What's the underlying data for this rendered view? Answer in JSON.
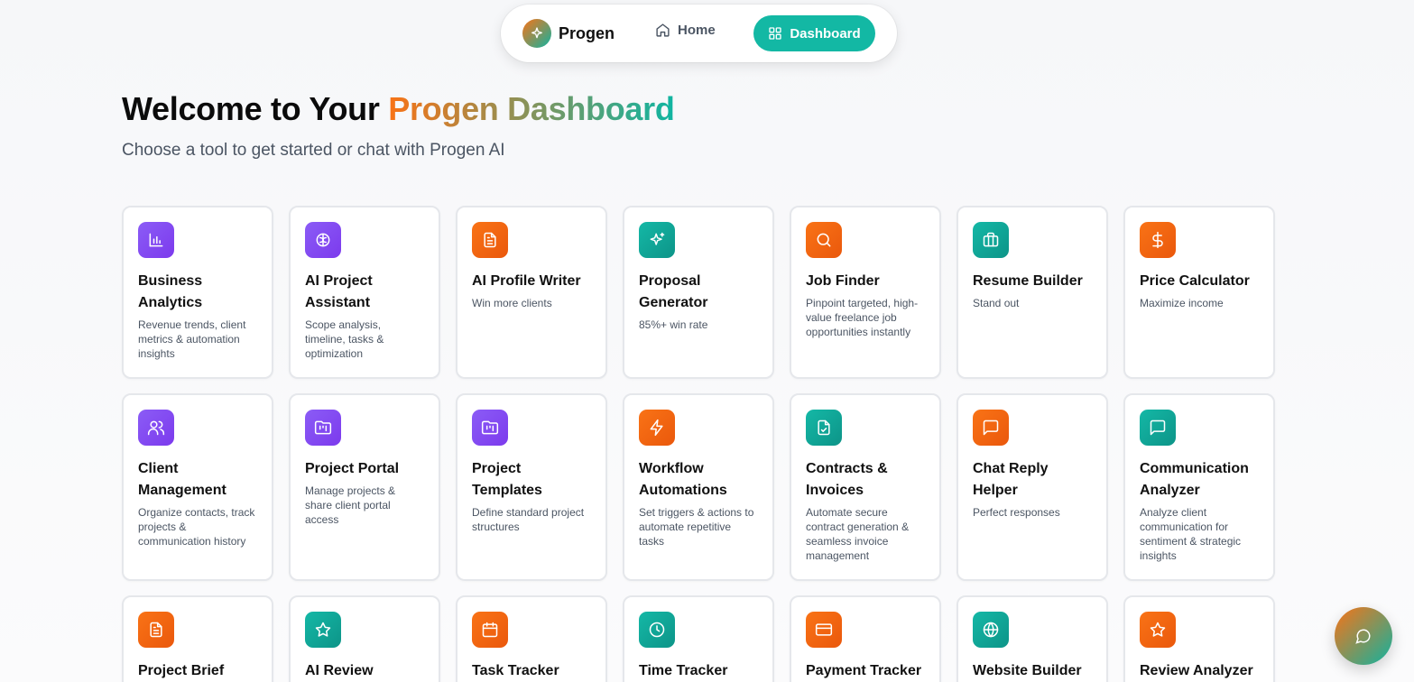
{
  "nav": {
    "brand": "Progen",
    "home_label": "Home",
    "dashboard_label": "Dashboard"
  },
  "header": {
    "title_prefix": "Welcome to Your ",
    "title_highlight": "Progen Dashboard",
    "subtitle": "Choose a tool to get started or chat with Progen AI"
  },
  "tools": [
    {
      "title": "Business Analytics",
      "desc": "Revenue trends, client metrics & automation insights",
      "color": "purple",
      "icon": "bar-chart-icon"
    },
    {
      "title": "AI Project Assistant",
      "desc": "Scope analysis, timeline, tasks & optimization",
      "color": "purple",
      "icon": "brain-icon"
    },
    {
      "title": "AI Profile Writer",
      "desc": "Win more clients",
      "color": "orange",
      "icon": "document-icon"
    },
    {
      "title": "Proposal Generator",
      "desc": "85%+ win rate",
      "color": "teal",
      "icon": "sparkles-icon"
    },
    {
      "title": "Job Finder",
      "desc": "Pinpoint targeted, high-value freelance job opportunities instantly",
      "color": "orange",
      "icon": "search-icon"
    },
    {
      "title": "Resume Builder",
      "desc": "Stand out",
      "color": "teal",
      "icon": "briefcase-icon"
    },
    {
      "title": "Price Calculator",
      "desc": "Maximize income",
      "color": "orange",
      "icon": "dollar-icon"
    },
    {
      "title": "Client Management",
      "desc": "Organize contacts, track projects & communication history",
      "color": "purple",
      "icon": "users-icon"
    },
    {
      "title": "Project Portal",
      "desc": "Manage projects & share client portal access",
      "color": "purple",
      "icon": "folder-kanban-icon"
    },
    {
      "title": "Project Templates",
      "desc": "Define standard project structures",
      "color": "purple",
      "icon": "folder-kanban-icon"
    },
    {
      "title": "Workflow Automations",
      "desc": "Set triggers & actions to automate repetitive tasks",
      "color": "orange",
      "icon": "lightning-icon"
    },
    {
      "title": "Contracts & Invoices",
      "desc": "Automate secure contract generation & seamless invoice management",
      "color": "teal",
      "icon": "file-check-icon"
    },
    {
      "title": "Chat Reply Helper",
      "desc": "Perfect responses",
      "color": "orange",
      "icon": "message-square-icon"
    },
    {
      "title": "Communication Analyzer",
      "desc": "Analyze client communication for sentiment & strategic insights",
      "color": "teal",
      "icon": "message-square-icon"
    },
    {
      "title": "Project Brief",
      "desc": "",
      "color": "orange",
      "icon": "document-icon"
    },
    {
      "title": "AI Review",
      "desc": "",
      "color": "teal",
      "icon": "star-icon"
    },
    {
      "title": "Task Tracker",
      "desc": "",
      "color": "orange",
      "icon": "calendar-icon"
    },
    {
      "title": "Time Tracker",
      "desc": "",
      "color": "teal",
      "icon": "clock-icon"
    },
    {
      "title": "Payment Tracker",
      "desc": "",
      "color": "orange",
      "icon": "credit-card-icon"
    },
    {
      "title": "Website Builder",
      "desc": "",
      "color": "teal",
      "icon": "globe-icon"
    },
    {
      "title": "Review Analyzer",
      "desc": "",
      "color": "orange",
      "icon": "star-icon"
    }
  ]
}
